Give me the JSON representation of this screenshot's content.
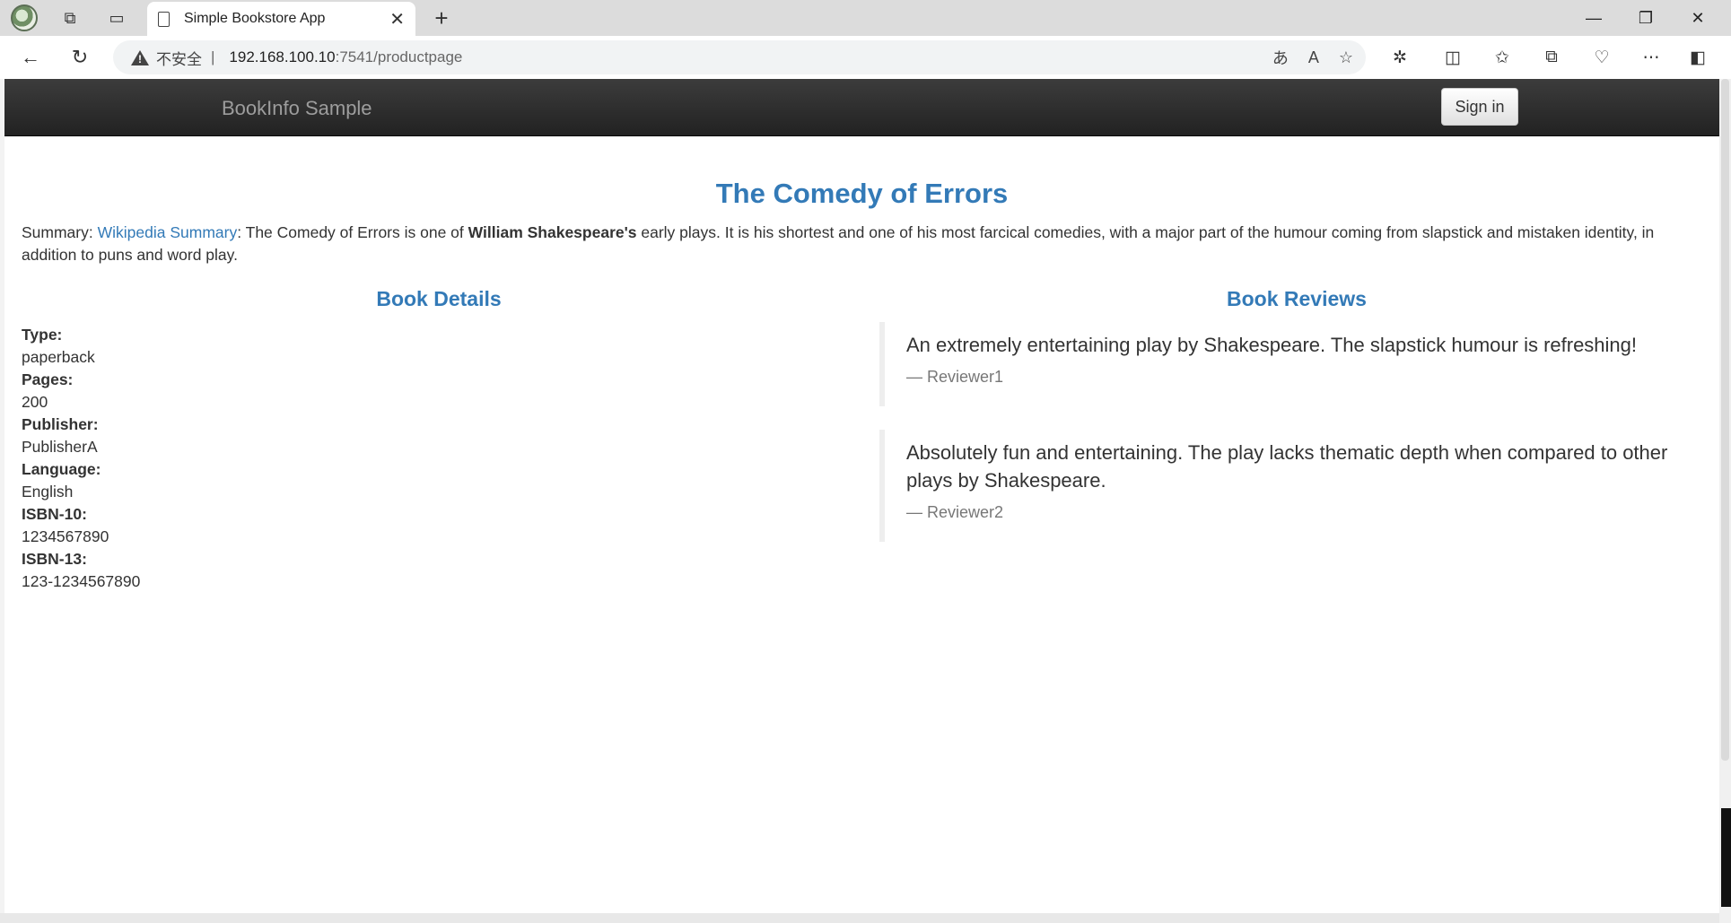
{
  "browser": {
    "tab_title": "Simple Bookstore App",
    "security_label": "不安全",
    "separator": "|",
    "url_host": "192.168.100.10",
    "url_rest": ":7541/productpage",
    "icons": [
      "profile-icon",
      "workspaces-icon",
      "vertical-tabs-icon",
      "page-icon",
      "close-icon",
      "new-tab-icon",
      "minimize-icon",
      "restore-icon",
      "window-close-icon",
      "back-icon",
      "refresh-icon",
      "warning-icon",
      "translate-icon",
      "read-aloud-icon",
      "favorite-icon",
      "extensions-icon",
      "split-screen-icon",
      "favorites-icon",
      "collections-icon",
      "performance-icon",
      "more-icon",
      "sidebar-icon"
    ]
  },
  "navbar": {
    "brand": "BookInfo Sample",
    "signin_label": "Sign in"
  },
  "product": {
    "title": "The Comedy of Errors",
    "summary_prefix": "Summary: ",
    "summary_link": "Wikipedia Summary",
    "summary_text_1": ": The Comedy of Errors is one of ",
    "summary_bold": "William Shakespeare's",
    "summary_text_2": " early plays. It is his shortest and one of his most farcical comedies, with a major part of the humour coming from slapstick and mistaken identity, in addition to puns and word play."
  },
  "details": {
    "heading": "Book Details",
    "items": [
      {
        "label": "Type:",
        "value": "paperback"
      },
      {
        "label": "Pages:",
        "value": "200"
      },
      {
        "label": "Publisher:",
        "value": "PublisherA"
      },
      {
        "label": "Language:",
        "value": "English"
      },
      {
        "label": "ISBN-10:",
        "value": "1234567890"
      },
      {
        "label": "ISBN-13:",
        "value": "123-1234567890"
      }
    ]
  },
  "reviews": {
    "heading": "Book Reviews",
    "items": [
      {
        "text": "An extremely entertaining play by Shakespeare. The slapstick humour is refreshing!",
        "author": "— Reviewer1"
      },
      {
        "text": "Absolutely fun and entertaining. The play lacks thematic depth when compared to other plays by Shakespeare.",
        "author": "— Reviewer2"
      }
    ]
  }
}
